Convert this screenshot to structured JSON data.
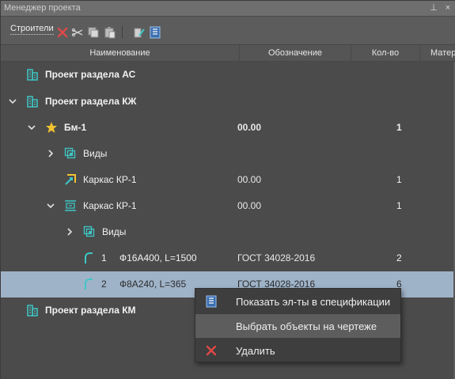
{
  "window": {
    "title": "Менеджер проекта",
    "pin_glyph": "⊥",
    "close_glyph": "×"
  },
  "toolbar": {
    "tab_label": "Строители",
    "tools": [
      "delete-icon",
      "cut-icon",
      "copy-icon",
      "paste-icon",
      "edit-icon",
      "spec-icon"
    ]
  },
  "table": {
    "columns": [
      "Наименование",
      "Обозначение",
      "Кол-во",
      "Матер"
    ]
  },
  "rows": [
    {
      "name": "Проект раздела АС",
      "bold": true,
      "expander": "none",
      "icon": "building-icon",
      "position": "",
      "designation": "",
      "qty": "",
      "selected": false
    },
    {
      "name": "Проект раздела КЖ",
      "bold": true,
      "expander": "expanded",
      "icon": "building-icon",
      "position": "",
      "designation": "",
      "qty": "",
      "selected": false
    },
    {
      "name": "Бм-1",
      "bold": true,
      "expander": "expanded",
      "icon": "star-icon",
      "position": "",
      "designation": "00.00",
      "qty": "1",
      "selected": false
    },
    {
      "name": "Виды",
      "bold": false,
      "expander": "collapsed",
      "icon": "views-icon",
      "position": "",
      "designation": "",
      "qty": "",
      "selected": false
    },
    {
      "name": "Каркас КР-1",
      "bold": false,
      "expander": "none",
      "icon": "frame-link-icon",
      "position": "",
      "designation": "00.00",
      "qty": "1",
      "selected": false
    },
    {
      "name": "Каркас КР-1",
      "bold": false,
      "expander": "expanded",
      "icon": "frame-icon",
      "position": "",
      "designation": "00.00",
      "qty": "1",
      "selected": false
    },
    {
      "name": "Виды",
      "bold": false,
      "expander": "collapsed",
      "icon": "views-icon",
      "position": "",
      "designation": "",
      "qty": "",
      "selected": false
    },
    {
      "name": "Ф16А400, L=1500",
      "bold": false,
      "expander": "none",
      "icon": "rebar-icon",
      "position": "1",
      "designation": "ГОСТ 34028-2016",
      "qty": "2",
      "selected": false
    },
    {
      "name": "Ф8А240, L=365",
      "bold": false,
      "expander": "none",
      "icon": "rebar-icon",
      "position": "2",
      "designation": "ГОСТ 34028-2016",
      "qty": "6",
      "selected": true
    },
    {
      "name": "Проект раздела КМ",
      "bold": true,
      "expander": "none",
      "icon": "building-icon",
      "position": "",
      "designation": "",
      "qty": "",
      "selected": false
    }
  ],
  "context_menu": {
    "items": [
      {
        "label": "Показать эл-ты в спецификации",
        "icon": "spec-icon",
        "hover": false
      },
      {
        "label": "Выбрать объекты на чертеже",
        "icon": "",
        "hover": true
      },
      {
        "label": "Удалить",
        "icon": "delete-icon",
        "hover": false
      }
    ]
  },
  "colors": {
    "accent_teal": "#3fc6c6",
    "delete_red": "#e04848",
    "selected_row": "#9fb3c8",
    "star_yellow": "#f2c230"
  }
}
